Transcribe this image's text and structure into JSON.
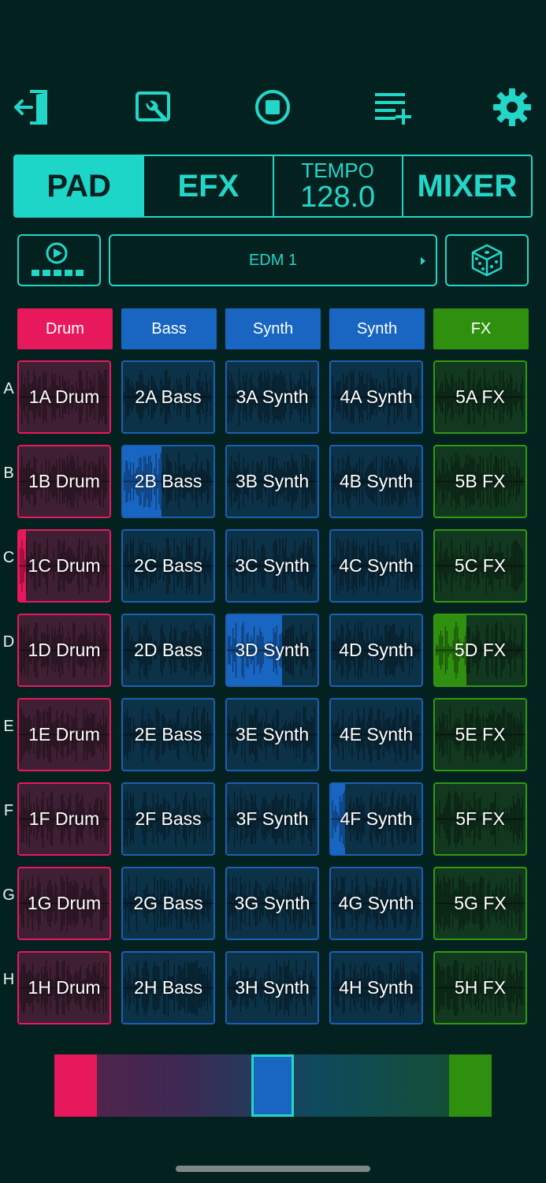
{
  "toolbar": {
    "icons": [
      "exit-icon",
      "wrench-icon",
      "stop-icon",
      "playlist-add-icon",
      "gear-icon"
    ],
    "accent": "#24d6c8"
  },
  "tabs": {
    "pad": "PAD",
    "efx": "EFX",
    "tempo_label": "TEMPO",
    "tempo_value": "128.0",
    "mixer": "MIXER",
    "active": "PAD"
  },
  "preset": {
    "name": "EDM 1"
  },
  "columns": [
    {
      "label": "Drum",
      "color": "#e8185c"
    },
    {
      "label": "Bass",
      "color": "#1866c2"
    },
    {
      "label": "Synth",
      "color": "#1866c2"
    },
    {
      "label": "Synth",
      "color": "#1866c2"
    },
    {
      "label": "FX",
      "color": "#2f8f0f"
    }
  ],
  "rows": [
    "A",
    "B",
    "C",
    "D",
    "E",
    "F",
    "G",
    "H"
  ],
  "pads": [
    [
      "1A Drum",
      "2A Bass",
      "3A Synth",
      "4A Synth",
      "5A FX"
    ],
    [
      "1B Drum",
      "2B Bass",
      "3B Synth",
      "4B Synth",
      "5B FX"
    ],
    [
      "1C Drum",
      "2C Bass",
      "3C Synth",
      "4C Synth",
      "5C FX"
    ],
    [
      "1D Drum",
      "2D Bass",
      "3D Synth",
      "4D Synth",
      "5D FX"
    ],
    [
      "1E Drum",
      "2E Bass",
      "3E Synth",
      "4E Synth",
      "5E FX"
    ],
    [
      "1F Drum",
      "2F Bass",
      "3F Synth",
      "4F Synth",
      "5F FX"
    ],
    [
      "1G Drum",
      "2G Bass",
      "3G Synth",
      "4G Synth",
      "5G FX"
    ],
    [
      "1H Drum",
      "2H Bass",
      "3H Synth",
      "4H Synth",
      "5H FX"
    ]
  ],
  "playing": [
    {
      "row": 1,
      "col": 1,
      "progress": 0.43
    },
    {
      "row": 2,
      "col": 0,
      "progress": 0.08
    },
    {
      "row": 3,
      "col": 2,
      "progress": 0.61
    },
    {
      "row": 3,
      "col": 4,
      "progress": 0.35
    },
    {
      "row": 5,
      "col": 3,
      "progress": 0.16
    }
  ],
  "crossfader": {
    "position": 0.5
  }
}
